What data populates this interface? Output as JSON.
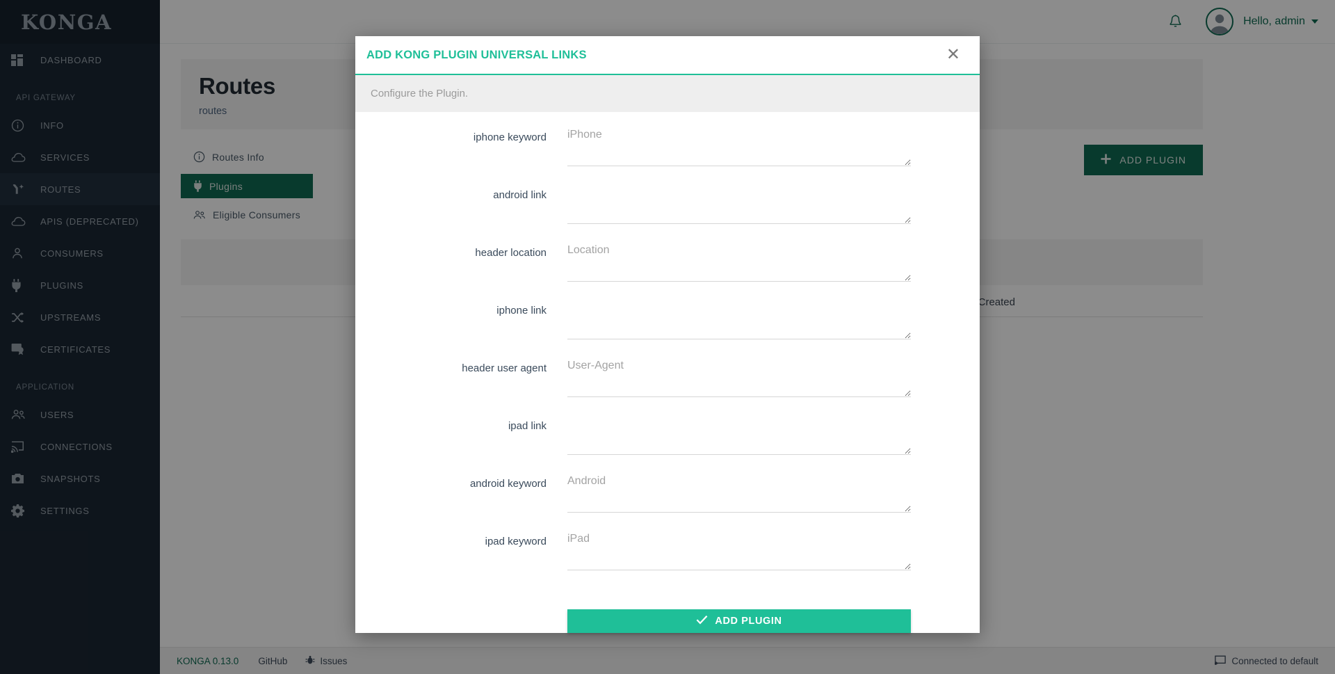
{
  "brand": {
    "name": "KONGA"
  },
  "sidebar": {
    "items": [
      {
        "label": "DASHBOARD",
        "icon": "dashboard-icon",
        "active": false
      },
      {
        "label": "INFO",
        "icon": "info-icon",
        "active": false
      },
      {
        "label": "SERVICES",
        "icon": "cloud-icon",
        "active": false
      },
      {
        "label": "ROUTES",
        "icon": "routes-icon",
        "active": true
      },
      {
        "label": "APIS (DEPRECATED)",
        "icon": "cloud-icon",
        "active": false
      },
      {
        "label": "CONSUMERS",
        "icon": "user-icon",
        "active": false
      },
      {
        "label": "PLUGINS",
        "icon": "plug-icon",
        "active": false
      },
      {
        "label": "UPSTREAMS",
        "icon": "shuffle-icon",
        "active": false
      },
      {
        "label": "CERTIFICATES",
        "icon": "certificate-icon",
        "active": false
      },
      {
        "label": "USERS",
        "icon": "users-icon",
        "active": false
      },
      {
        "label": "CONNECTIONS",
        "icon": "connection-icon",
        "active": false
      },
      {
        "label": "SNAPSHOTS",
        "icon": "camera-icon",
        "active": false
      },
      {
        "label": "SETTINGS",
        "icon": "gear-icon",
        "active": false
      }
    ],
    "section_api_gateway": "API GATEWAY",
    "section_application": "APPLICATION"
  },
  "topbar": {
    "bell_icon": "bell-icon",
    "avatar_icon": "avatar",
    "greeting": "Hello, admin",
    "caret_icon": "chevron-down-icon"
  },
  "page": {
    "title": "Routes",
    "breadcrumb": "routes",
    "tabs": [
      {
        "label": "Routes Info",
        "icon": "info-icon",
        "active": false
      },
      {
        "label": "Plugins",
        "icon": "plug-icon",
        "active": true
      },
      {
        "label": "Eligible Consumers",
        "icon": "users-icon",
        "active": false
      }
    ],
    "add_plugin_button": "ADD PLUGIN",
    "add_plugin_icon": "plus-icon",
    "table_header_created": "Created"
  },
  "modal": {
    "title": "ADD KONG PLUGIN UNIVERSAL LINKS",
    "close_icon": "close-icon",
    "subtitle": "Configure the Plugin.",
    "fields": [
      {
        "label": "iphone keyword",
        "placeholder": "iPhone",
        "value": "",
        "name": "iphone-keyword"
      },
      {
        "label": "android link",
        "placeholder": "",
        "value": "",
        "name": "android-link"
      },
      {
        "label": "header location",
        "placeholder": "Location",
        "value": "",
        "name": "header-location"
      },
      {
        "label": "iphone link",
        "placeholder": "",
        "value": "",
        "name": "iphone-link"
      },
      {
        "label": "header user agent",
        "placeholder": "User-Agent",
        "value": "",
        "name": "header-user-agent"
      },
      {
        "label": "ipad link",
        "placeholder": "",
        "value": "",
        "name": "ipad-link"
      },
      {
        "label": "android keyword",
        "placeholder": "Android",
        "value": "",
        "name": "android-keyword"
      },
      {
        "label": "ipad keyword",
        "placeholder": "iPad",
        "value": "",
        "name": "ipad-keyword"
      }
    ],
    "submit_label": "ADD PLUGIN",
    "submit_icon": "check-icon"
  },
  "footer": {
    "version": "KONGA 0.13.0",
    "github": "GitHub",
    "issues": "Issues",
    "issues_icon": "bug-icon",
    "connection": "Connected to default",
    "connection_icon": "connection-icon"
  },
  "colors": {
    "accent_teal": "#1fbf98",
    "brand_green": "#0f6b52",
    "sidebar_bg": "#1b2733"
  }
}
